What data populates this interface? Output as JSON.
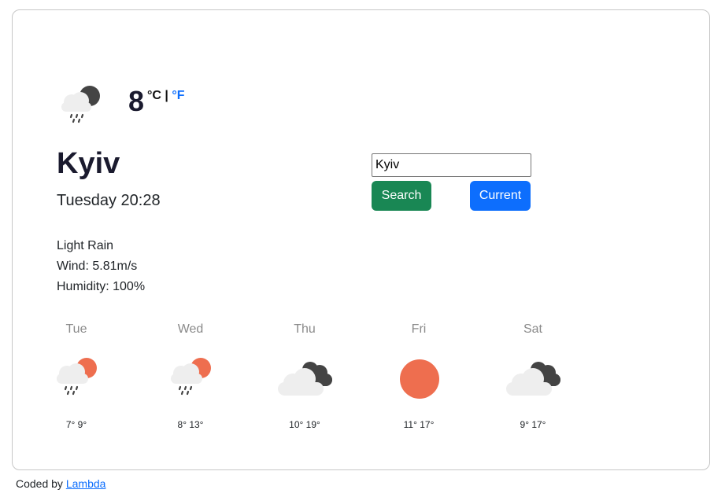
{
  "current": {
    "icon": "rain-cloud-dark-icon",
    "temperature": "8",
    "unit_celsius": "°C",
    "unit_separator": "|",
    "unit_fahrenheit": "°F",
    "city": "Kyiv",
    "datetime": "Tuesday 20:28",
    "description": "Light Rain",
    "wind": "Wind: 5.81m/s",
    "humidity": "Humidity: 100%"
  },
  "search": {
    "value": "Kyiv",
    "search_label": "Search",
    "current_label": "Current"
  },
  "forecast": [
    {
      "day": "Tue",
      "temps": "7° 9°",
      "icon": "rain-cloud-sun-icon"
    },
    {
      "day": "Wed",
      "temps": "8° 13°",
      "icon": "rain-cloud-sun-icon"
    },
    {
      "day": "Thu",
      "temps": "10° 19°",
      "icon": "dark-clouds-icon"
    },
    {
      "day": "Fri",
      "temps": "11° 17°",
      "icon": "sun-icon"
    },
    {
      "day": "Sat",
      "temps": "9° 17°",
      "icon": "dark-clouds-icon"
    }
  ],
  "footer": {
    "prefix": "Coded by ",
    "link_text": "Lambda"
  },
  "colors": {
    "sun": "#ee6e4f",
    "dark_cloud": "#444444",
    "light_cloud": "#eeeeee",
    "search_button": "#198754",
    "current_button": "#0d6efd"
  }
}
